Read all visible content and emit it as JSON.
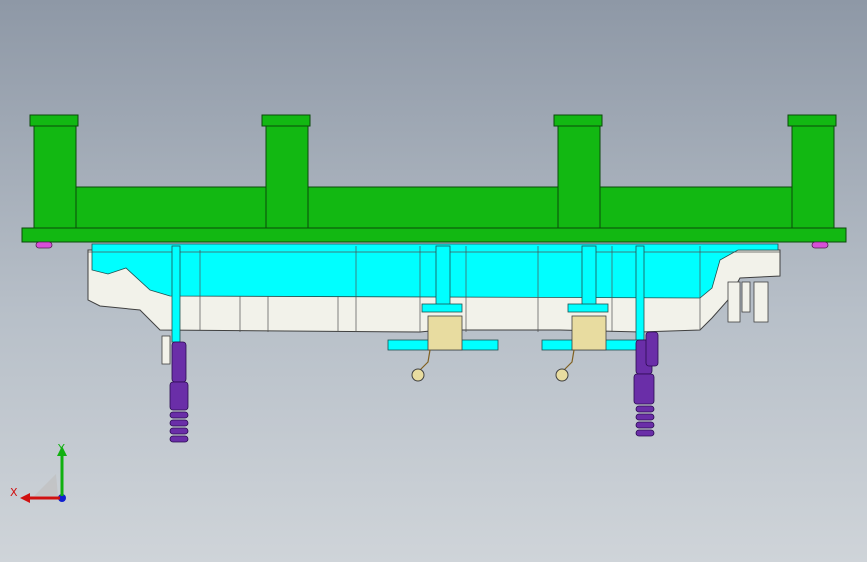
{
  "viewport": {
    "background_top": "#8e98a6",
    "background_bottom": "#cfd4d9"
  },
  "model": {
    "frame_color": "#12b812",
    "frame_outline": "#0a4a0a",
    "cavity_color": "#00ffff",
    "insert_color": "#f2f2ea",
    "spring_color": "#6a2ea8",
    "clamp_color": "#e8dca0",
    "pad_color": "#d84fd8"
  },
  "triad": {
    "x_label": "X",
    "y_label": "Y",
    "x_color": "#d01010",
    "y_color": "#10b010",
    "z_color": "#1020d0"
  }
}
